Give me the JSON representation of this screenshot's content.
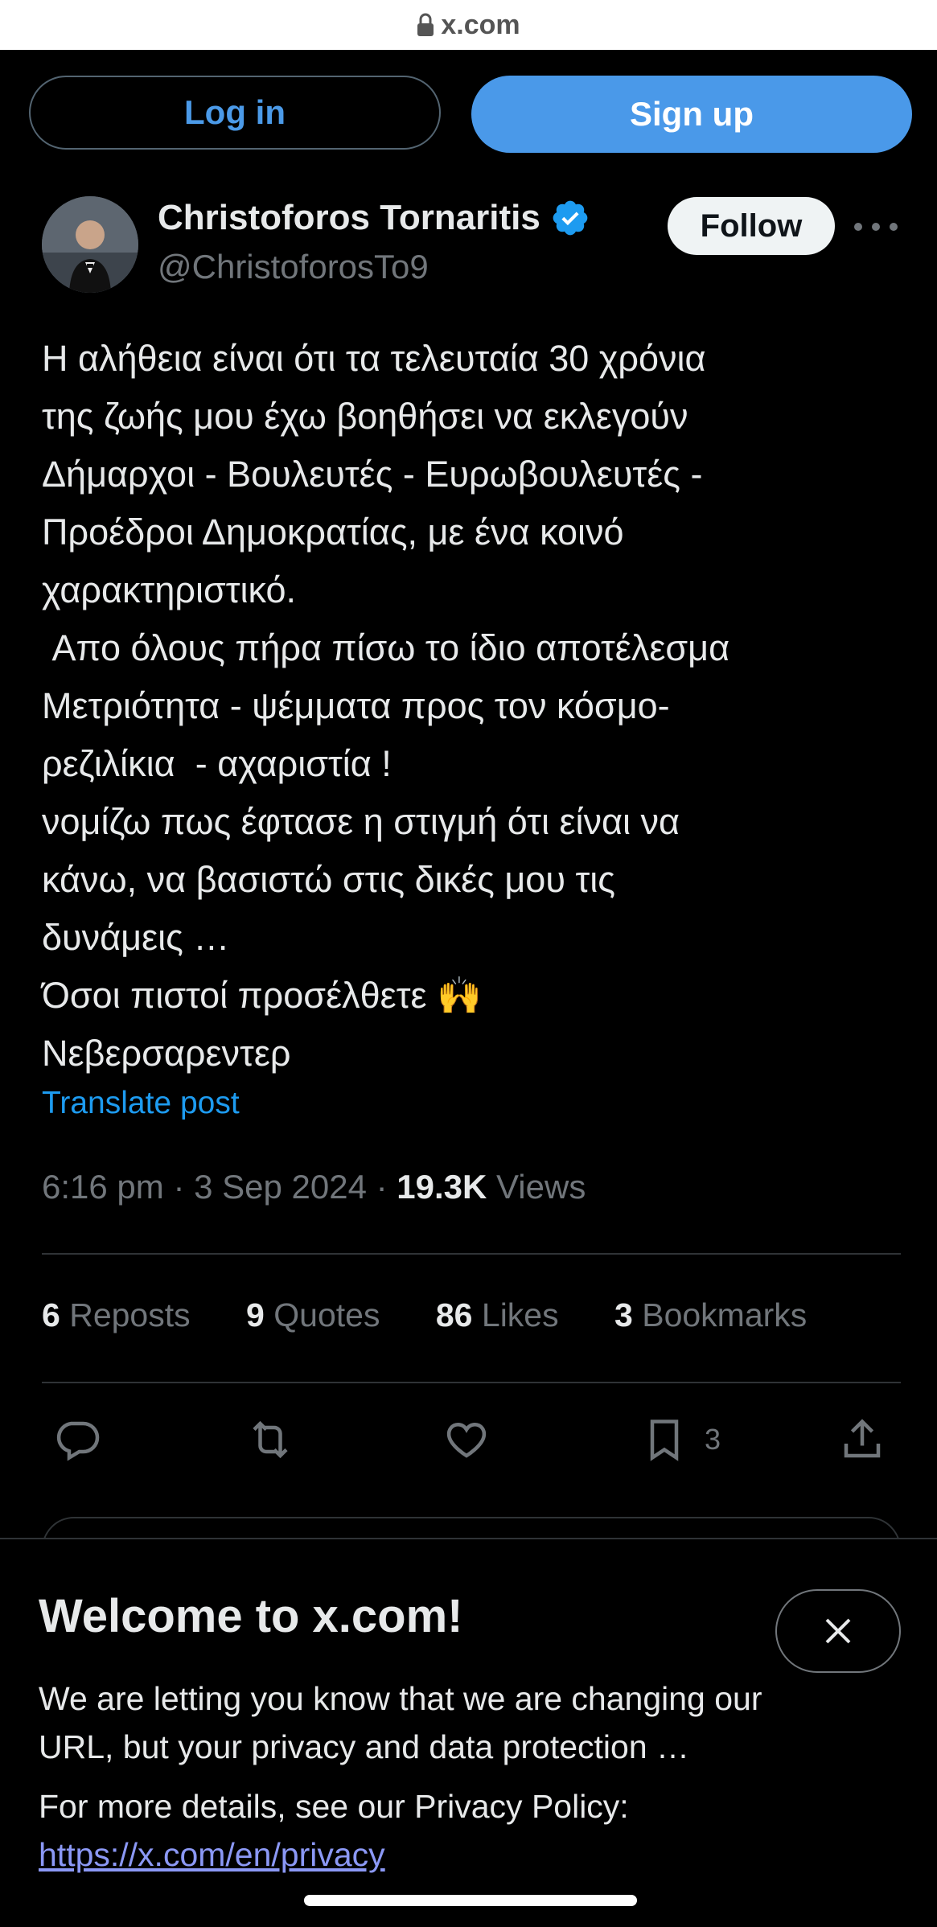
{
  "browser": {
    "url": "x.com"
  },
  "auth": {
    "login_label": "Log in",
    "signup_label": "Sign up"
  },
  "author": {
    "name": "Christoforos Tornaritis",
    "handle": "@ChristoforosTo9",
    "verified": true,
    "follow_label": "Follow"
  },
  "post": {
    "text": "Η αλήθεια είναι ότι τα τελευταία 30 χρόνια\nτης ζωής μου έχω βοηθήσει να εκλεγούν\nΔήμαρχοι - Βουλευτές - Ευρωβουλευτές -\nΠροέδροι Δημοκρατίας, με ένα κοινό\nχαρακτηριστικό.\n Απο όλους πήρα πίσω το ίδιο αποτέλεσμα\nΜετριότητα - ψέμματα προς τον κόσμο-\nρεζιλίκια  - αχαριστία !\nνομίζω πως έφτασε η στιγμή ότι είναι να\nκάνω, να βασιστώ στις δικές μου τις\nδυνάμεις …\nΌσοι πιστοί προσέλθετε 🙌\nΝεβερσαρεντερ",
    "translate_label": "Translate post",
    "time": "6:16 pm",
    "date": "3 Sep 2024",
    "views_count": "19.3K",
    "views_label": "Views"
  },
  "stats": {
    "reposts_count": "6",
    "reposts_label": "Reposts",
    "quotes_count": "9",
    "quotes_label": "Quotes",
    "likes_count": "86",
    "likes_label": "Likes",
    "bookmarks_count": "3",
    "bookmarks_label": "Bookmarks"
  },
  "actions": {
    "reply_icon": "reply-icon",
    "repost_icon": "repost-icon",
    "like_icon": "heart-icon",
    "bookmark_icon": "bookmark-icon",
    "bookmark_count": "3",
    "share_icon": "share-icon"
  },
  "banner": {
    "title": "Welcome to x.com!",
    "body": "We are letting you know that we are changing our URL, but your privacy and data protection …",
    "more": "For more details, see our Privacy Policy:",
    "link": "https://x.com/en/privacy"
  },
  "colors": {
    "background": "#000000",
    "accent": "#4a99e9",
    "link": "#1d9bf0",
    "muted": "#71767b"
  }
}
